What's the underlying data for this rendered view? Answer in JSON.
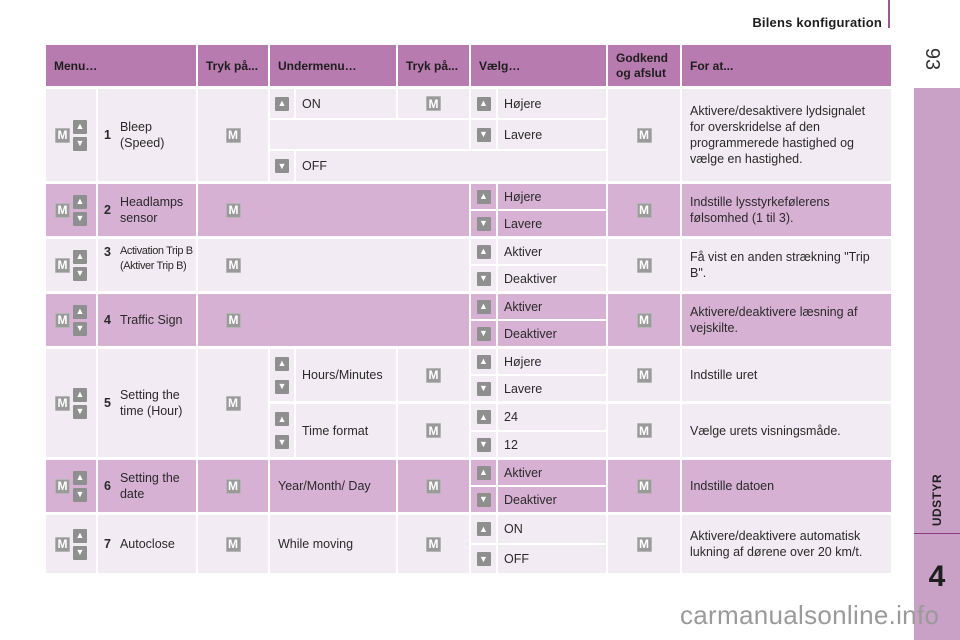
{
  "page": {
    "section_title": "Bilens konfiguration",
    "page_number": "93",
    "side_tab_label": "UDSTYR",
    "chapter_number": "4",
    "watermark": "carmanualsonline.info",
    "colors": {
      "header": "#b87baf",
      "row_light": "#f3ebf3",
      "row_dark": "#d7b1d3",
      "side_tab": "#c9a0c6",
      "button": "#8f8f8f"
    }
  },
  "icons": {
    "m_button": "M",
    "up_arrow": "▲",
    "down_arrow": "▼"
  },
  "table": {
    "headers": {
      "menu": "Menu…",
      "press1": "Tryk på...",
      "submenu": "Undermenu…",
      "press2": "Tryk på...",
      "select": "Vælg…",
      "confirm": "Godkend og afslut",
      "purpose": "For at..."
    },
    "rows": [
      {
        "num": "1",
        "menu": "Bleep (Speed)",
        "submenus": [
          {
            "label": "ON",
            "arrow": "up"
          },
          {
            "label": "OFF",
            "arrow": "down"
          }
        ],
        "options": [
          {
            "label": "Højere",
            "arrow": "up"
          },
          {
            "label": "Lavere",
            "arrow": "down"
          }
        ],
        "purpose": "Aktivere/desaktivere lydsignalet for overskridelse af den programmerede hastighed og vælge en hastighed."
      },
      {
        "num": "2",
        "menu": "Headlamps sensor",
        "options": [
          {
            "label": "Højere",
            "arrow": "up"
          },
          {
            "label": "Lavere",
            "arrow": "down"
          }
        ],
        "purpose": "Indstille lysstyrkefølerens følsomhed (1 til 3)."
      },
      {
        "num": "3",
        "menu": "Activation Trip B (Aktiver Trip B)",
        "options": [
          {
            "label": "Aktiver",
            "arrow": "up"
          },
          {
            "label": "Deaktiver",
            "arrow": "down"
          }
        ],
        "purpose": "Få vist en anden strækning \"Trip B\"."
      },
      {
        "num": "4",
        "menu": "Traffic Sign",
        "options": [
          {
            "label": "Aktiver",
            "arrow": "up"
          },
          {
            "label": "Deaktiver",
            "arrow": "down"
          }
        ],
        "purpose": "Aktivere/deaktivere læsning af vejskilte."
      },
      {
        "num": "5",
        "menu": "Setting the time (Hour)",
        "groups": [
          {
            "submenu": "Hours/Minutes",
            "options": [
              {
                "label": "Højere",
                "arrow": "up"
              },
              {
                "label": "Lavere",
                "arrow": "down"
              }
            ],
            "purpose": "Indstille uret"
          },
          {
            "submenu": "Time format",
            "options": [
              {
                "label": "24",
                "arrow": "up"
              },
              {
                "label": "12",
                "arrow": "down"
              }
            ],
            "purpose": "Vælge urets visningsmåde."
          }
        ]
      },
      {
        "num": "6",
        "menu": "Setting the date",
        "submenu": "Year/Month/ Day",
        "options": [
          {
            "label": "Aktiver",
            "arrow": "up"
          },
          {
            "label": "Deaktiver",
            "arrow": "down"
          }
        ],
        "purpose": "Indstille datoen"
      },
      {
        "num": "7",
        "menu": "Autoclose",
        "submenu": "While moving",
        "options": [
          {
            "label": "ON",
            "arrow": "up"
          },
          {
            "label": "OFF",
            "arrow": "down"
          }
        ],
        "purpose": "Aktivere/deaktivere automatisk lukning af dørene over 20 km/t."
      }
    ]
  }
}
